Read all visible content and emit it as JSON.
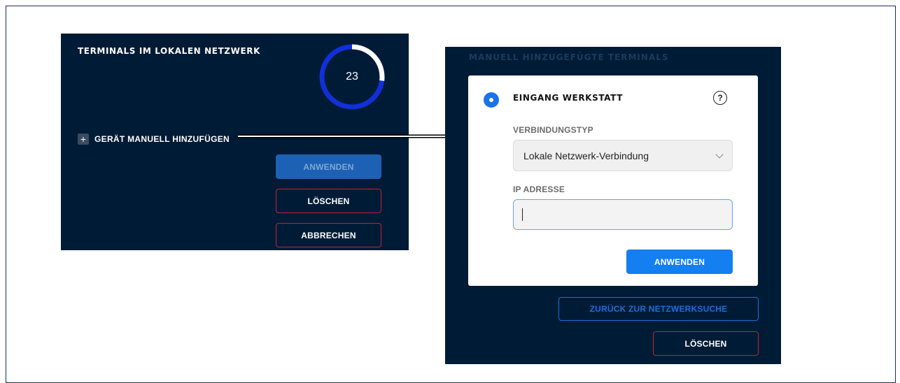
{
  "left_panel": {
    "title": "TERMINALS IM LOKALEN NETZWERK",
    "terminal_count": "23",
    "ring_fill_fraction": 0.27,
    "add_device_label": "GERÄT MANUELL HINZUFÜGEN",
    "buttons": {
      "apply": "ANWENDEN",
      "delete": "LÖSCHEN",
      "cancel": "ABBRECHEN"
    }
  },
  "right_panel": {
    "faded_title": "MANUELL HINZUGEFÜGTE TERMINALS",
    "card": {
      "title": "EINGANG WERKSTATT",
      "help_symbol": "?",
      "connection_label": "VERBINDUNGSTYP",
      "connection_value": "Lokale Netzwerk-Verbindung",
      "ip_label": "IP ADRESSE",
      "ip_value": "",
      "apply_button": "ANWENDEN"
    },
    "back_button": "ZURÜCK ZUR NETZWERKSUCHE",
    "delete_button": "LÖSCHEN"
  },
  "colors": {
    "panel_bg": "#001b36",
    "primary_blue": "#137ff0",
    "danger_red": "#c1223a"
  }
}
